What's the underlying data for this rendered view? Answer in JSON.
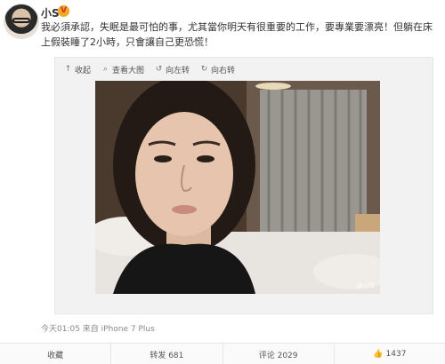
{
  "post": {
    "username": "小S",
    "verified_badge": "V",
    "text": "我必須承認，失眠是最可怕的事，尤其當你明天有很重要的工作，要專業要漂亮！但躺在床上假裝睡了2小時，只會讓自己更恐慌！",
    "meta": "今天01:05 来自 iPhone 7 Plus",
    "watermark": "@小S"
  },
  "media_toolbar": {
    "collapse": {
      "label": "收起",
      "icon": "collapse-icon"
    },
    "view_large": {
      "label": "查看大图",
      "icon": "zoom-icon"
    },
    "rotate_left": {
      "label": "向左转",
      "icon": "rotate-left-icon"
    },
    "rotate_right": {
      "label": "向右转",
      "icon": "rotate-right-icon"
    }
  },
  "actions": {
    "favorite": {
      "label": "收藏"
    },
    "repost": {
      "label": "转发 681"
    },
    "comment": {
      "label": "评论 2029"
    },
    "like": {
      "label": "1437",
      "icon": "thumbs-up-icon"
    }
  },
  "colors": {
    "badge": "#f5a623",
    "text": "#333333",
    "muted": "#888888",
    "panel": "#f2f2f2"
  }
}
